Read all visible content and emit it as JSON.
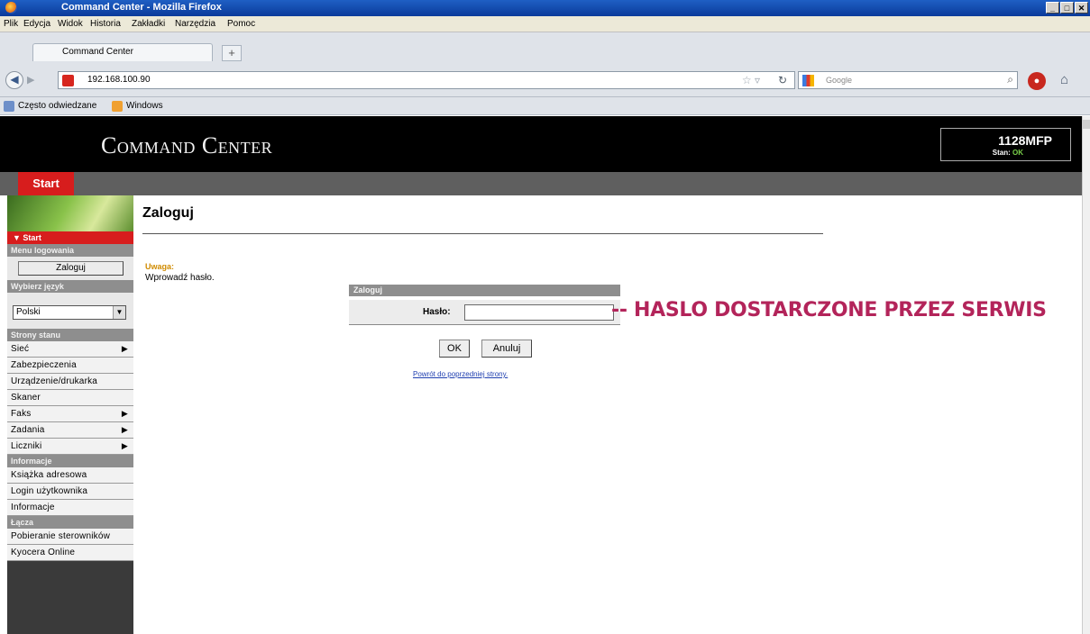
{
  "browser": {
    "window_title": "Command Center - Mozilla Firefox",
    "menu": [
      "Plik",
      "Edycja",
      "Widok",
      "Historia",
      "Zakładki",
      "Narzędzia",
      "Pomoc"
    ],
    "tab_title": "Command Center",
    "url": "192.168.100.90",
    "search_placeholder": "Google",
    "bookmarks": [
      "Często odwiedzane",
      "Windows"
    ]
  },
  "header": {
    "title": "Command Center",
    "model": "1128MFP",
    "status_label": "Stan:",
    "status_value": "OK"
  },
  "nav": {
    "start_tab": "Start"
  },
  "sidebar": {
    "start": "▼ Start",
    "login_menu_title": "Menu logowania",
    "login_button": "Zaloguj",
    "language_title": "Wybierz język",
    "language_value": "Polski",
    "status_pages_title": "Strony stanu",
    "status_items": [
      "Sieć",
      "Zabezpieczenia",
      "Urządzenie/drukarka",
      "Skaner",
      "Faks",
      "Zadania",
      "Liczniki"
    ],
    "info_title": "Informacje",
    "info_items": [
      "Książka adresowa",
      "Login użytkownika",
      "Informacje"
    ],
    "links_title": "Łącza",
    "links_items": [
      "Pobieranie sterowników",
      "Kyocera Online"
    ]
  },
  "main": {
    "title": "Zaloguj",
    "warning_label": "Uwaga:",
    "warning_text": "Wprowadź hasło.",
    "panel_title": "Zaloguj",
    "password_label": "Hasło:",
    "ok_button": "OK",
    "cancel_button": "Anuluj",
    "back_link": "Powrót do poprzedniej strony."
  },
  "annotation": "-- HASLO DOSTARCZONE PRZEZ SERWIS",
  "colors": {
    "accent_red": "#d71d1d",
    "annotation": "#b3245a",
    "status_ok": "#7ad14a"
  }
}
